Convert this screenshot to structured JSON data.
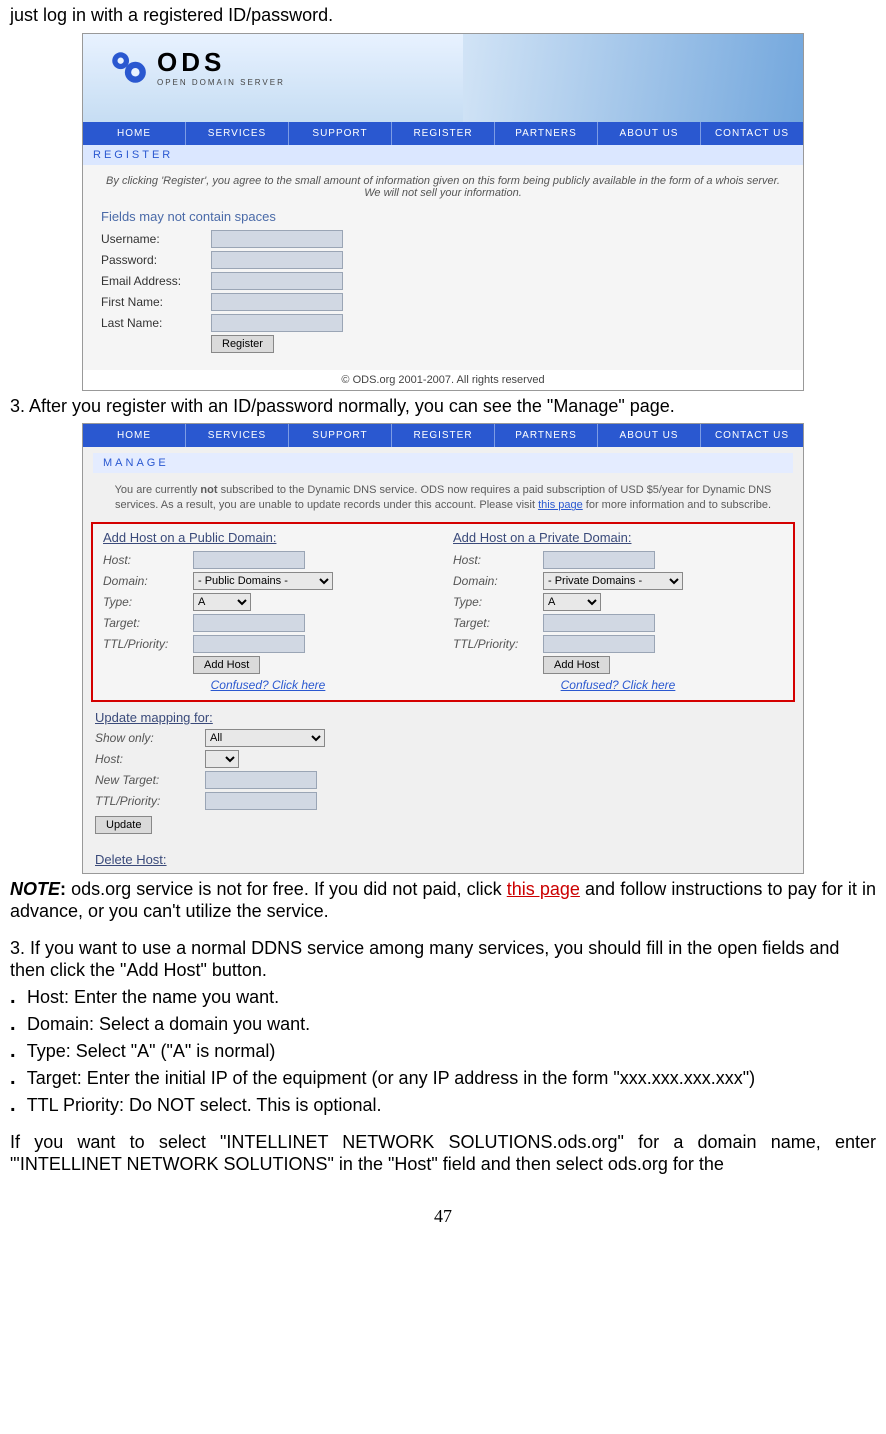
{
  "doc": {
    "line_top": "just log in with a registered ID/password.",
    "step3a": "3. After you register with an ID/password normally, you can see the \"Manage\" page.",
    "note_label": "NOTE",
    "note_colon": ": ",
    "note_body1": "ods.org service is not for free. If you did not paid, click ",
    "note_link": "this page",
    "note_body2": " and follow instructions to pay for it in advance, or you can't utilize the service.",
    "step3b": "3. If you want to use a normal DDNS service among many services, you should fill in the open fields and then click the \"Add Host\" button.",
    "bullets": [
      "Host: Enter the name you want.",
      "Domain: Select a domain you want.",
      "Type: Select \"A\" (\"A\" is normal)",
      "Target: Enter the initial IP of the equipment (or any IP address in the form \"xxx.xxx.xxx.xxx\")",
      "TTL Priority: Do NOT select. This is optional."
    ],
    "closing": "If you want to select \"INTELLINET NETWORK SOLUTIONS.ods.org\" for a domain name, enter \"'INTELLINET NETWORK SOLUTIONS\" in the \"Host\" field and then select ods.org for the",
    "page_number": "47"
  },
  "shot1": {
    "logo_name": "ODS",
    "logo_sub": "OPEN DOMAIN SERVER",
    "nav": [
      "HOME",
      "SERVICES",
      "SUPPORT",
      "REGISTER",
      "PARTNERS",
      "ABOUT US",
      "CONTACT US"
    ],
    "section": "REGISTER",
    "info": "By clicking 'Register', you agree to the small amount of information given on this form being publicly available in the form of a whois server. We will not sell your information.",
    "form_title": "Fields may not contain spaces",
    "fields": [
      "Username:",
      "Password:",
      "Email Address:",
      "First Name:",
      "Last Name:"
    ],
    "button": "Register",
    "copyright": "© ODS.org 2001-2007. All rights reserved"
  },
  "shot2": {
    "nav": [
      "HOME",
      "SERVICES",
      "SUPPORT",
      "REGISTER",
      "PARTNERS",
      "ABOUT US",
      "CONTACT US"
    ],
    "section": "MANAGE",
    "info_a": "You are currently ",
    "info_not": "not",
    "info_b": " subscribed to the Dynamic DNS service. ODS now requires a paid subscription of USD $5/year for Dynamic DNS services. As a result, you are unable to update records under this account. Please visit ",
    "info_link": "this page",
    "info_c": " for more information and to subscribe.",
    "colA_title": "Add Host on a Public Domain:",
    "colB_title": "Add Host on a Private Domain:",
    "row_labels": [
      "Host:",
      "Domain:",
      "Type:",
      "Target:",
      "TTL/Priority:"
    ],
    "domain_public": "- Public Domains -",
    "domain_private": "- Private Domains -",
    "type_value": "A",
    "add_host_btn": "Add Host",
    "confused": "Confused? Click here",
    "update_title": "Update mapping for:",
    "show_only_label": "Show only:",
    "show_only_value": "All",
    "host_label": "Host:",
    "new_target_label": "New Target:",
    "ttl_label": "TTL/Priority:",
    "update_btn": "Update",
    "delete_title": "Delete Host:"
  }
}
